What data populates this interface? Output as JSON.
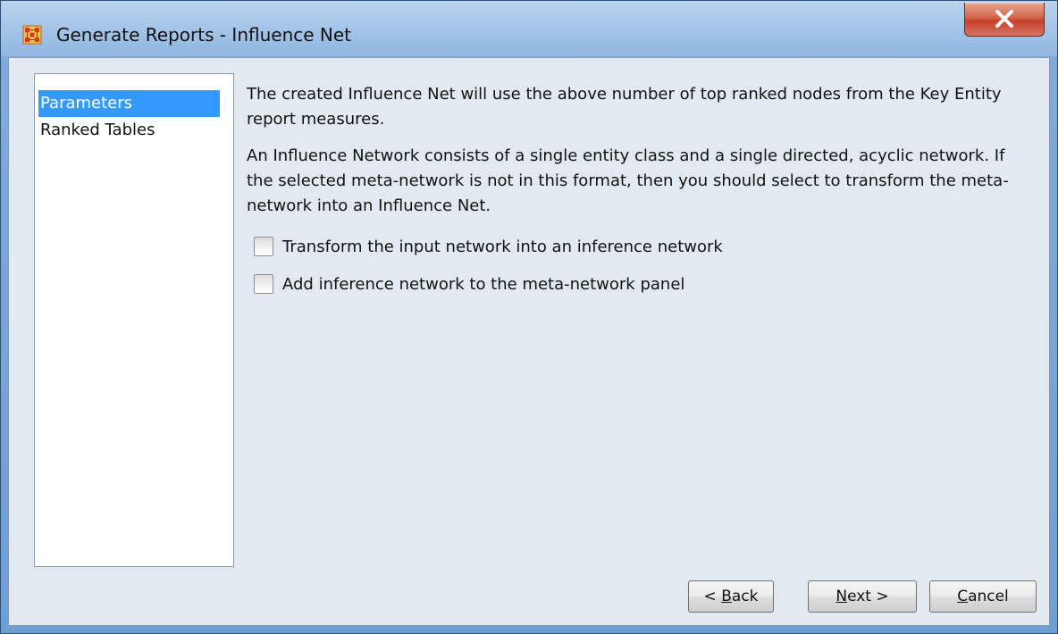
{
  "window": {
    "title": "Generate Reports - Influence Net",
    "app_icon": "grid-network-icon",
    "close_icon": "close-icon"
  },
  "nav": {
    "items": [
      {
        "label": "Parameters",
        "selected": true
      },
      {
        "label": "Ranked Tables",
        "selected": false
      }
    ]
  },
  "content": {
    "paragraph1": "The created Influence Net will use the above number of top ranked nodes from the Key Entity report measures.",
    "paragraph2": "An Influence Network consists of a single entity class and a single directed, acyclic network. If the selected meta-network is not in this format, then you should select to transform the meta-network into an Influence Net.",
    "checkboxes": [
      {
        "label": "Transform the input network into an inference network",
        "checked": false
      },
      {
        "label": "Add inference network to the meta-network panel",
        "checked": false
      }
    ]
  },
  "buttons": {
    "back": {
      "prefix": "< ",
      "mnemonic": "B",
      "rest": "ack"
    },
    "next": {
      "prefix": "",
      "mnemonic": "N",
      "rest": "ext >"
    },
    "cancel": {
      "prefix": "",
      "mnemonic": "C",
      "rest": "ancel"
    }
  },
  "colors": {
    "titlebar": "#a7c6e8",
    "selection": "#3399ff",
    "close_button": "#c4402a",
    "client_background": "#e3e9f1"
  }
}
